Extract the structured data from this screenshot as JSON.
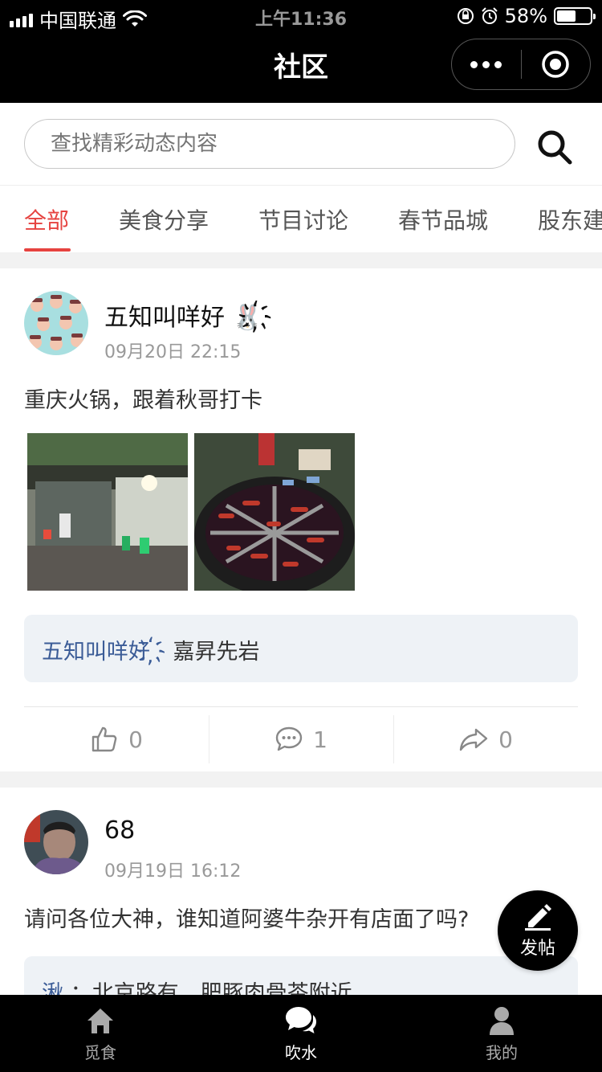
{
  "status_bar": {
    "carrier": "中国联通",
    "time": "上午11:36",
    "battery": "58%",
    "battery_level": 0.58
  },
  "nav": {
    "title": "社区",
    "more_icon": "more-dots-icon",
    "close_icon": "target-icon"
  },
  "search": {
    "placeholder": "查找精彩动态内容",
    "icon": "search-icon"
  },
  "tabs": [
    {
      "label": "全部",
      "active": true
    },
    {
      "label": "美食分享",
      "active": false
    },
    {
      "label": "节目讨论",
      "active": false
    },
    {
      "label": "春节品城",
      "active": false
    },
    {
      "label": "股东建",
      "active": false
    }
  ],
  "posts": [
    {
      "username": "五知叫咩好 🐰҉",
      "time": "09月20日 22:15",
      "content": "重庆火锅，跟着秋哥打卡",
      "comment_author": "五知叫咩好 ҉",
      "comment_text": "嘉昇先岩",
      "likes": "0",
      "comments": "1",
      "shares": "0"
    },
    {
      "username": "68",
      "time": "09月19日 16:12",
      "content": "请问各位大神，谁知道阿婆牛杂开有店面了吗?",
      "comment_author": "湫",
      "comment_text": "：北京路有，肥豚肉骨茶附近"
    }
  ],
  "fab": {
    "label": "发帖",
    "icon": "edit-pencil-icon"
  },
  "tabbar": [
    {
      "label": "觅食",
      "icon": "home-icon",
      "active": false
    },
    {
      "label": "吹水",
      "icon": "chat-bubbles-icon",
      "active": true
    },
    {
      "label": "我的",
      "icon": "user-icon",
      "active": false
    }
  ],
  "colors": {
    "accent": "#e64340",
    "comment_author": "#3b5c97",
    "comment_bg": "#eef2f6"
  }
}
